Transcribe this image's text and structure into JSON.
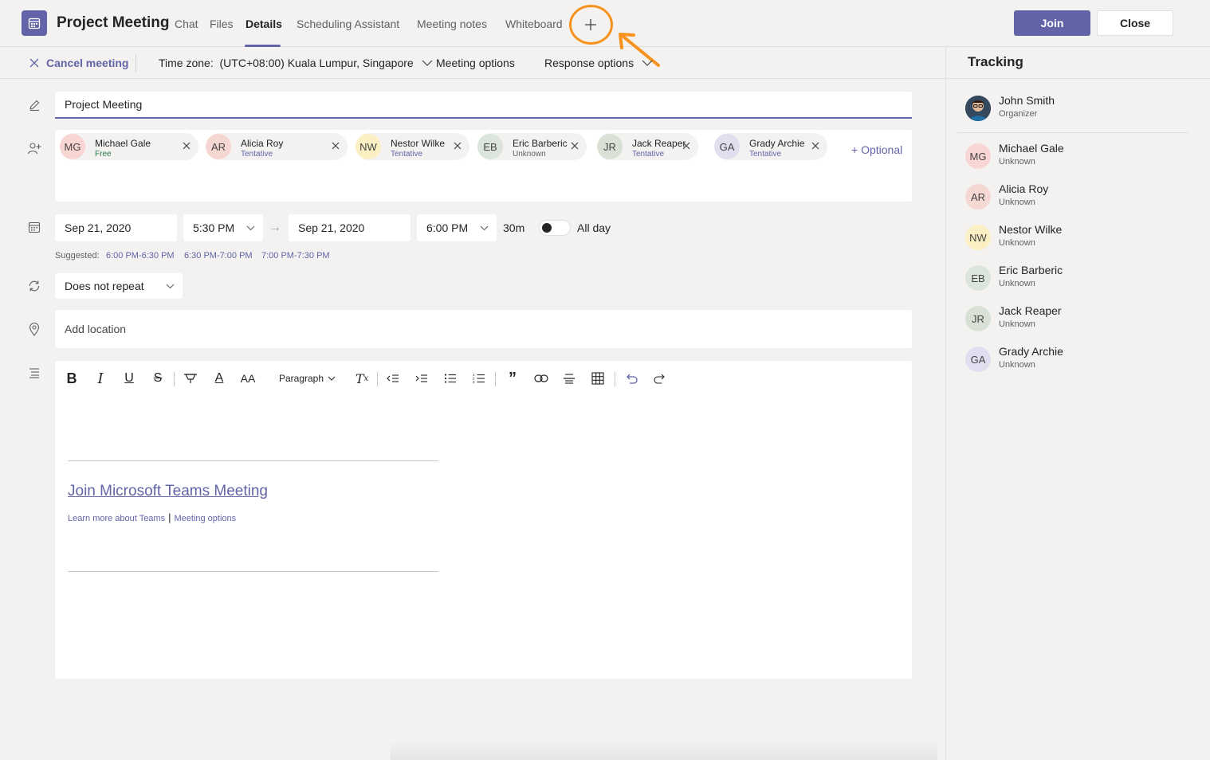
{
  "header": {
    "title": "Project Meeting",
    "tabs": [
      "Chat",
      "Files",
      "Details",
      "Scheduling Assistant",
      "Meeting notes",
      "Whiteboard"
    ],
    "active_tab": "Details",
    "add_tab_icon": "plus-icon",
    "join_label": "Join",
    "close_label": "Close",
    "accent_color": "#6264a7",
    "annotation_color": "#f7921e"
  },
  "toolbar": {
    "cancel_label": "Cancel meeting",
    "timezone_label": "Time zone:  (UTC+08:00) Kuala Lumpur, Singapore",
    "meeting_options_label": "Meeting options",
    "response_options_label": "Response options"
  },
  "form": {
    "title_value": "Project Meeting",
    "attendees": [
      {
        "initials": "MG",
        "name": "Michael Gale",
        "status": "Free",
        "status_color": "#237b4b",
        "avatar_color": "#f9d6d4"
      },
      {
        "initials": "AR",
        "name": "Alicia Roy",
        "status": "Tentative",
        "status_color": "#6264a7",
        "avatar_color": "#f6d8d3"
      },
      {
        "initials": "NW",
        "name": "Nestor Wilke",
        "status": "Tentative",
        "status_color": "#6264a7",
        "avatar_color": "#fbefc4"
      },
      {
        "initials": "EB",
        "name": "Eric Barberic",
        "status": "Unknown",
        "status_color": "#616161",
        "avatar_color": "#dce5dc"
      },
      {
        "initials": "JR",
        "name": "Jack Reaper",
        "status": "Tentative",
        "status_color": "#6264a7",
        "avatar_color": "#d9e0d6"
      },
      {
        "initials": "GA",
        "name": "Grady Archie",
        "status": "Tentative",
        "status_color": "#6264a7",
        "avatar_color": "#e2def0"
      }
    ],
    "optional_label": "+ Optional",
    "start_date": "Sep 21, 2020",
    "start_time": "5:30 PM",
    "end_date": "Sep 21, 2020",
    "end_time": "6:00 PM",
    "duration": "30m",
    "all_day_label": "All day",
    "suggested_label": "Suggested:",
    "suggestions": [
      "6:00 PM-6:30 PM",
      "6:30 PM-7:00 PM",
      "7:00 PM-7:30 PM"
    ],
    "repeat_value": "Does not repeat",
    "location_placeholder": "Add location"
  },
  "editor": {
    "paragraph_label": "Paragraph",
    "join_link": "Join Microsoft Teams Meeting",
    "learn_more": "Learn more about Teams",
    "meeting_options": "Meeting options"
  },
  "tracking": {
    "title": "Tracking",
    "organizer": {
      "name": "John Smith",
      "role": "Organizer"
    },
    "people": [
      {
        "initials": "MG",
        "name": "Michael Gale",
        "status": "Unknown",
        "avatar_color": "#f9d6d4"
      },
      {
        "initials": "AR",
        "name": "Alicia Roy",
        "status": "Unknown",
        "avatar_color": "#f6d8d3"
      },
      {
        "initials": "NW",
        "name": "Nestor Wilke",
        "status": "Unknown",
        "avatar_color": "#fbefc4"
      },
      {
        "initials": "EB",
        "name": "Eric Barberic",
        "status": "Unknown",
        "avatar_color": "#dce5dc"
      },
      {
        "initials": "JR",
        "name": "Jack Reaper",
        "status": "Unknown",
        "avatar_color": "#d9e0d6"
      },
      {
        "initials": "GA",
        "name": "Grady Archie",
        "status": "Unknown",
        "avatar_color": "#e2def0"
      }
    ]
  }
}
